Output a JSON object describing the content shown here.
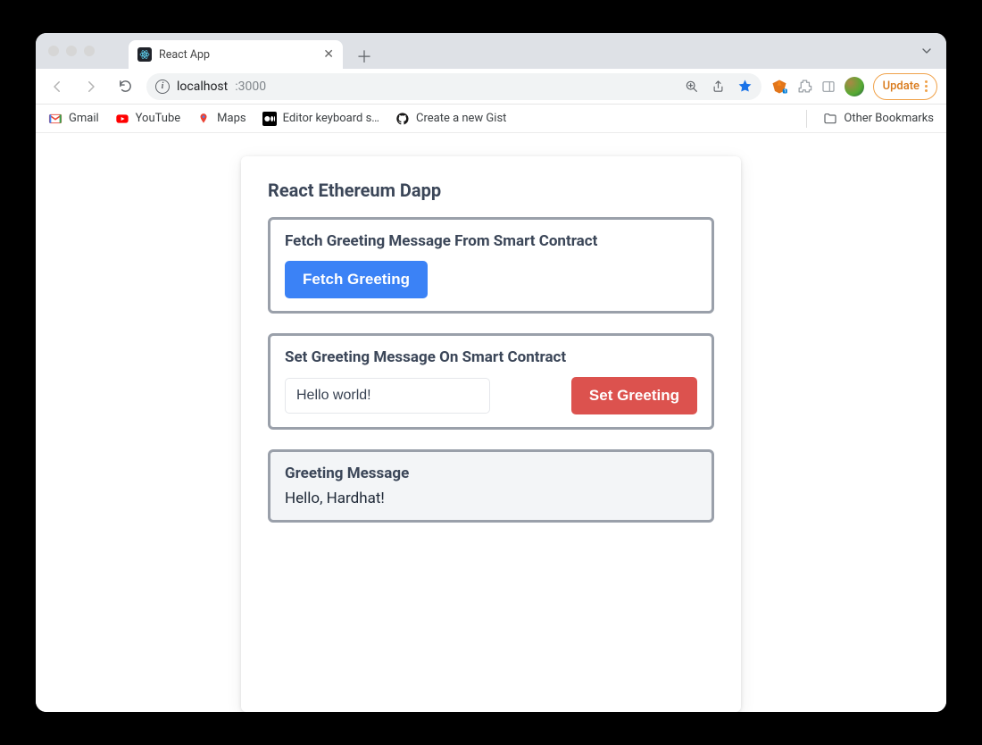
{
  "browser": {
    "tab_title": "React App",
    "url_host": "localhost",
    "url_port": ":3000",
    "update_label": "Update"
  },
  "bookmarks": {
    "items": [
      {
        "label": "Gmail"
      },
      {
        "label": "YouTube"
      },
      {
        "label": "Maps"
      },
      {
        "label": "Editor keyboard s…"
      },
      {
        "label": "Create a new Gist"
      }
    ],
    "other_label": "Other Bookmarks"
  },
  "app": {
    "title": "React Ethereum Dapp",
    "fetch": {
      "heading": "Fetch Greeting Message From Smart Contract",
      "button": "Fetch Greeting"
    },
    "set": {
      "heading": "Set Greeting Message On Smart Contract",
      "input_value": "Hello world!",
      "button": "Set Greeting"
    },
    "result": {
      "heading": "Greeting Message",
      "value": "Hello, Hardhat!"
    }
  }
}
